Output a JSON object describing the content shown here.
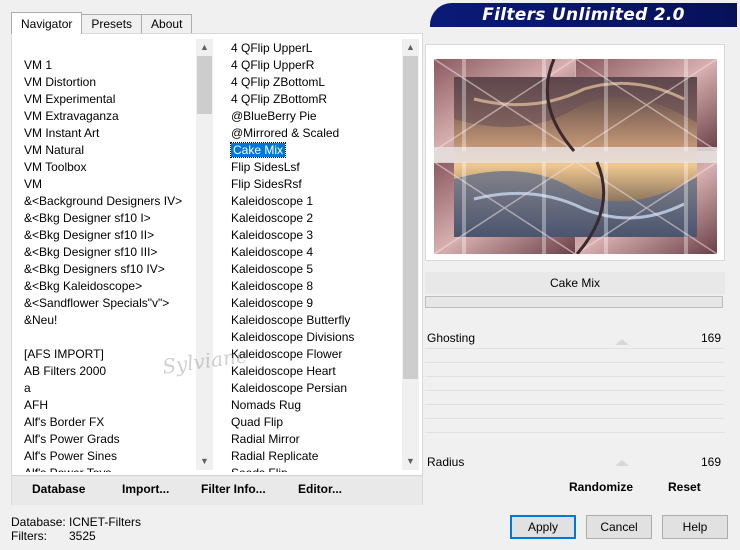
{
  "window_title": "Filters Unlimited 2.0",
  "tabs": [
    {
      "label": "Navigator",
      "active": true
    },
    {
      "label": "Presets",
      "active": false
    },
    {
      "label": "About",
      "active": false
    }
  ],
  "categories": [
    "",
    "VM 1",
    "VM Distortion",
    "VM Experimental",
    "VM Extravaganza",
    "VM Instant Art",
    "VM Natural",
    "VM Toolbox",
    "VM",
    "&<Background Designers IV>",
    "&<Bkg Designer sf10 I>",
    "&<Bkg Designer sf10 II>",
    "&<Bkg Designer sf10 III>",
    "&<Bkg Designers sf10 IV>",
    "&<Bkg Kaleidoscope>",
    "&<Sandflower Specials\"v\">",
    "&Neu!",
    "",
    "[AFS IMPORT]",
    "AB Filters 2000",
    "a",
    "AFH",
    "Alf's Border FX",
    "Alf's Power Grads",
    "Alf's Power Sines",
    "Alf's Power Toys"
  ],
  "filters": [
    "4 QFlip UpperL",
    "4 QFlip UpperR",
    "4 QFlip ZBottomL",
    "4 QFlip ZBottomR",
    "@BlueBerry Pie",
    "@Mirrored & Scaled",
    "Cake Mix",
    "Flip SidesLsf",
    "Flip SidesRsf",
    "Kaleidoscope 1",
    "Kaleidoscope 2",
    "Kaleidoscope 3",
    "Kaleidoscope 4",
    "Kaleidoscope 5",
    "Kaleidoscope 8",
    "Kaleidoscope 9",
    "Kaleidoscope Butterfly",
    "Kaleidoscope Divisions",
    "Kaleidoscope Flower",
    "Kaleidoscope Heart",
    "Kaleidoscope Persian",
    "Nomads Rug",
    "Quad Flip",
    "Radial Mirror",
    "Radial Replicate",
    "Seeds Flip"
  ],
  "selected_filter_index": 6,
  "bottom_buttons": {
    "database": "Database",
    "import": "Import...",
    "filter_info": "Filter Info...",
    "editor": "Editor..."
  },
  "watermark": "Sylviane",
  "preview": {
    "filter_name": "Cake Mix",
    "params": [
      {
        "label": "Ghosting",
        "value": "169"
      },
      {
        "label": "Radius",
        "value": "169"
      }
    ]
  },
  "actions": {
    "randomize": "Randomize",
    "reset": "Reset"
  },
  "status": {
    "database_label": "Database:",
    "database_value": "ICNET-Filters",
    "filters_label": "Filters:",
    "filters_value": "3525"
  },
  "dialog_buttons": {
    "apply": "Apply",
    "cancel": "Cancel",
    "help": "Help"
  }
}
